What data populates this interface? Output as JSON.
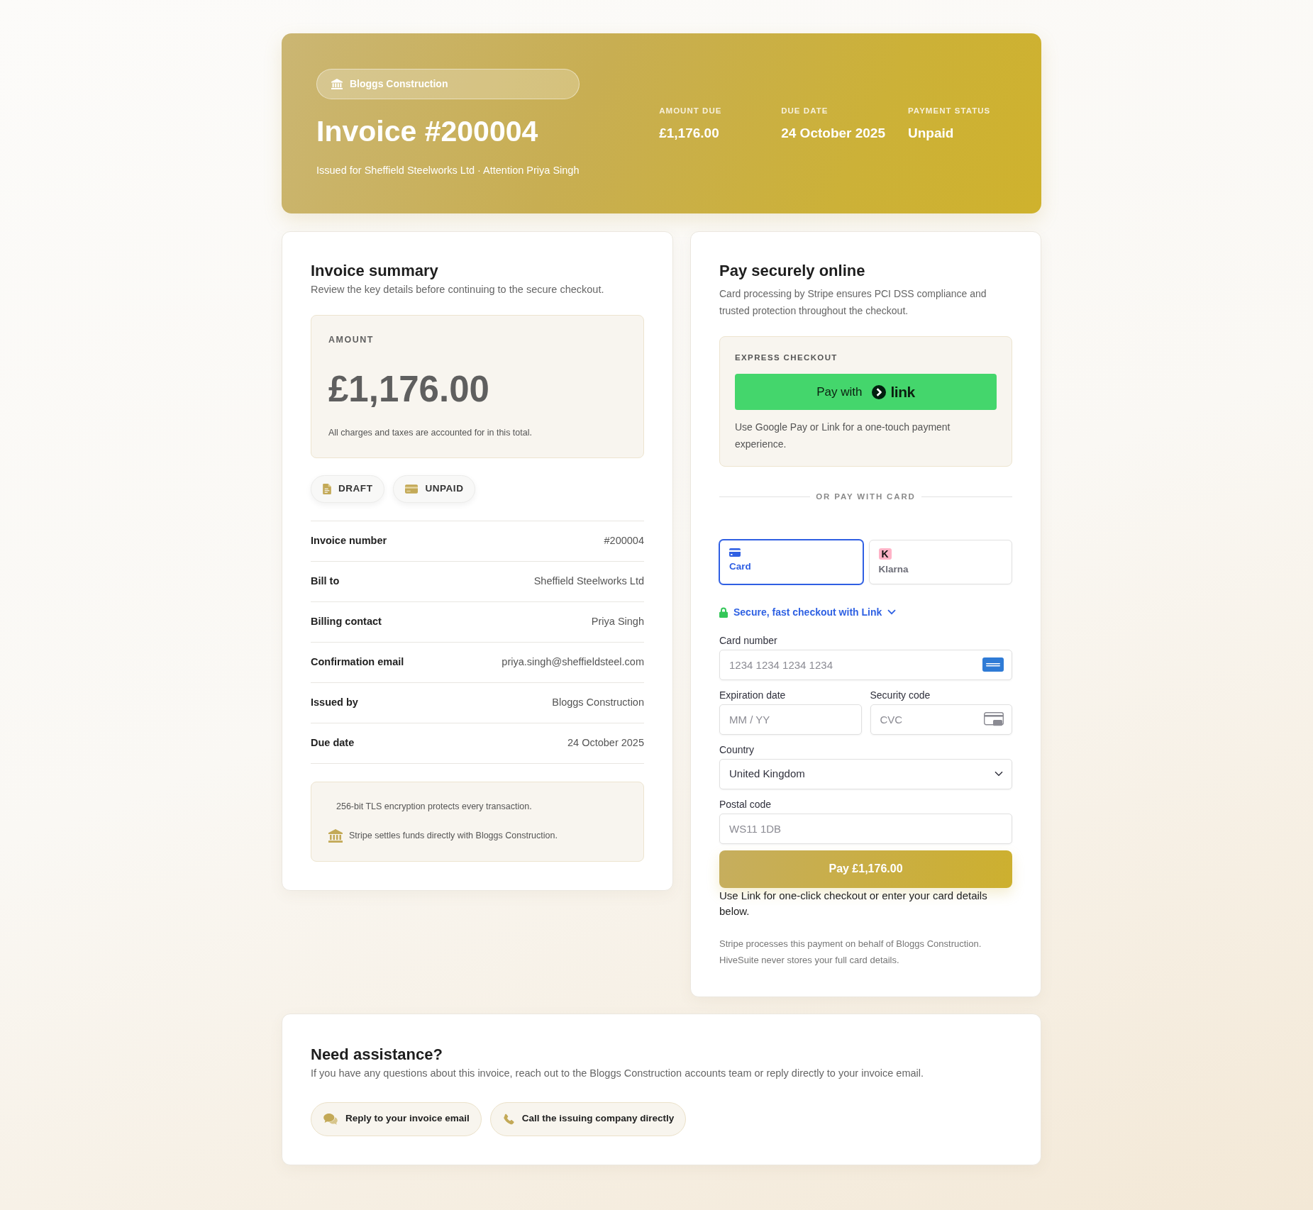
{
  "header": {
    "company": "Bloggs Construction",
    "title": "Invoice #200004",
    "subtitle": "Issued for Sheffield Steelworks Ltd · Attention Priya Singh",
    "stats": [
      {
        "label": "AMOUNT DUE",
        "value": "£1,176.00"
      },
      {
        "label": "DUE DATE",
        "value": "24 October 2025"
      },
      {
        "label": "PAYMENT STATUS",
        "value": "Unpaid"
      }
    ]
  },
  "summary": {
    "title": "Invoice summary",
    "description": "Review the key details before continuing to the secure checkout.",
    "amount": {
      "label": "AMOUNT",
      "value": "£1,176.00",
      "note": "All charges and taxes are accounted for in this total."
    },
    "badges": [
      {
        "kind": "document",
        "label": "DRAFT"
      },
      {
        "kind": "card",
        "label": "UNPAID"
      }
    ],
    "details": [
      {
        "label": "Invoice number",
        "value": "#200004"
      },
      {
        "label": "Bill to",
        "value": "Sheffield Steelworks Ltd"
      },
      {
        "label": "Billing contact",
        "value": "Priya Singh"
      },
      {
        "label": "Confirmation email",
        "value": "priya.singh@sheffieldsteel.com"
      },
      {
        "label": "Issued by",
        "value": "Bloggs Construction"
      },
      {
        "label": "Due date",
        "value": "24 October 2025"
      }
    ],
    "security_notes": [
      {
        "kind": "plain",
        "text": "256-bit TLS encryption protects every transaction."
      },
      {
        "kind": "bank",
        "text": "Stripe settles funds directly with Bloggs Construction."
      }
    ]
  },
  "payment": {
    "title": "Pay securely online",
    "description": "Card processing by Stripe ensures PCI DSS compliance and trusted protection throughout the checkout.",
    "express": {
      "label": "EXPRESS CHECKOUT",
      "button": {
        "text": "Pay with",
        "logo_text": "link"
      },
      "note": "Use Google Pay or Link for a one-touch payment experience."
    },
    "divider": "OR PAY WITH CARD",
    "methods": [
      {
        "kind": "card",
        "label": "Card",
        "selected": true
      },
      {
        "kind": "letter",
        "letter": "K",
        "label": "Klarna",
        "selected": false
      }
    ],
    "link_notice": "Secure, fast checkout with Link",
    "field_rows": [
      [
        {
          "kind": "card_number",
          "label": "Card number",
          "placeholder": "1234 1234 1234 1234"
        }
      ],
      [
        {
          "kind": "text",
          "label": "Expiration date",
          "placeholder": "MM / YY"
        },
        {
          "kind": "cvc",
          "label": "Security code",
          "placeholder": "CVC"
        }
      ],
      [
        {
          "kind": "select",
          "label": "Country",
          "value": "United Kingdom"
        }
      ],
      [
        {
          "kind": "text",
          "label": "Postal code",
          "placeholder": "WS11 1DB"
        }
      ]
    ],
    "pay_button": "Pay £1,176.00",
    "hint": "Use Link for one-click checkout or enter your card details below.",
    "footnote": "Stripe processes this payment on behalf of Bloggs Construction. HiveSuite never stores your full card details."
  },
  "assistance": {
    "title": "Need assistance?",
    "description": "If you have any questions about this invoice, reach out to the Bloggs Construction accounts team or reply directly to your invoice email.",
    "actions": [
      {
        "kind": "chat",
        "label": "Reply to your invoice email"
      },
      {
        "kind": "phone",
        "label": "Call the issuing company directly"
      }
    ]
  }
}
